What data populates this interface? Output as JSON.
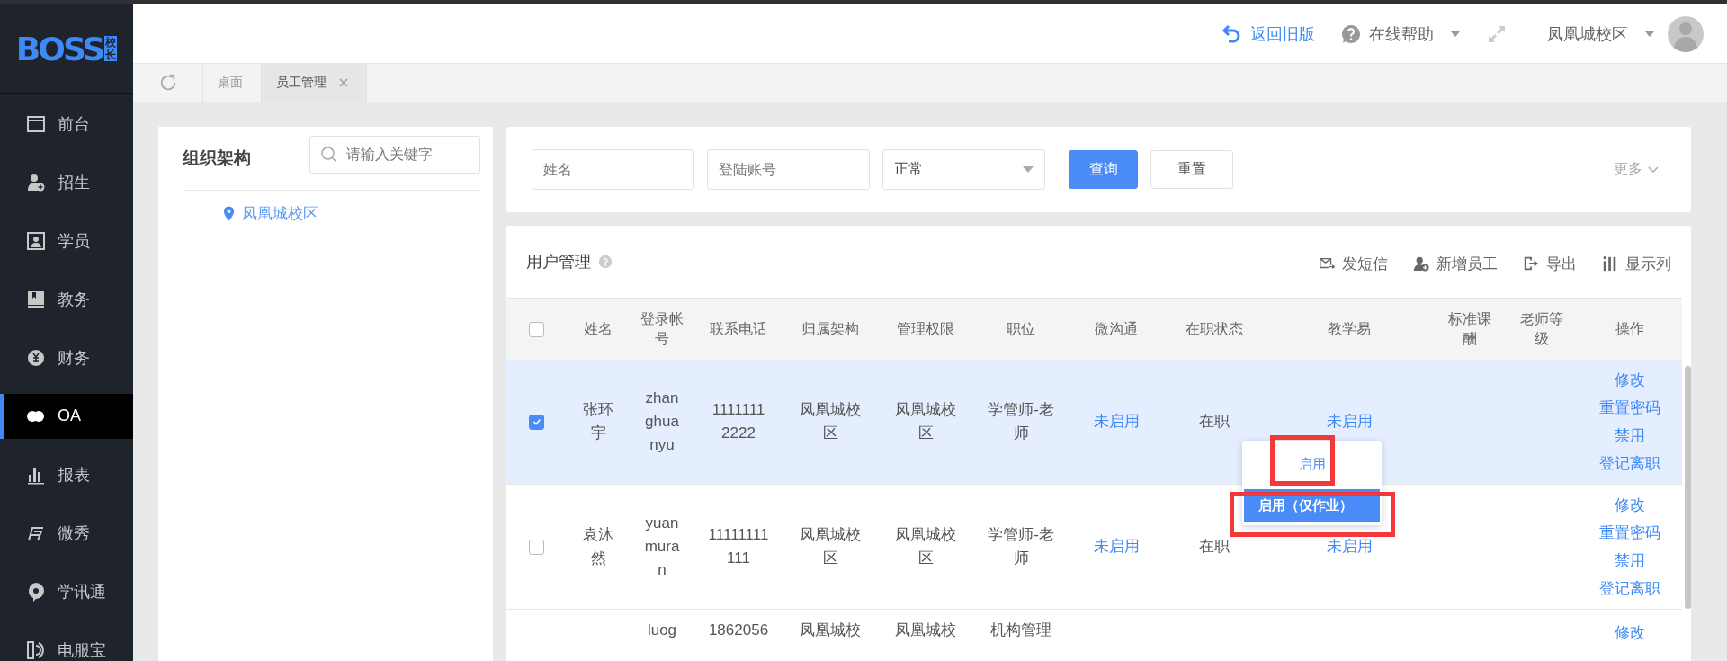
{
  "logo": {
    "text": "BOSS",
    "badge": "校长"
  },
  "sidebar": {
    "items": [
      {
        "label": "前台",
        "selected": false
      },
      {
        "label": "招生",
        "selected": false
      },
      {
        "label": "学员",
        "selected": false
      },
      {
        "label": "教务",
        "selected": false
      },
      {
        "label": "财务",
        "selected": false
      },
      {
        "label": "OA",
        "selected": true
      },
      {
        "label": "报表",
        "selected": false
      },
      {
        "label": "微秀",
        "selected": false
      },
      {
        "label": "学讯通",
        "selected": false
      },
      {
        "label": "电服宝",
        "selected": false
      }
    ]
  },
  "header": {
    "back_link": "返回旧版",
    "help": "在线帮助",
    "campus": "凤凰城校区"
  },
  "tabs": [
    {
      "label": "桌面",
      "selected": false,
      "closable": false
    },
    {
      "label": "员工管理",
      "selected": true,
      "closable": true
    }
  ],
  "org_panel": {
    "title": "组织架构",
    "search_placeholder": "请输入关键字",
    "tree": [
      {
        "label": "凤凰城校区"
      }
    ]
  },
  "filters": {
    "name_placeholder": "姓名",
    "account_placeholder": "登陆账号",
    "status_value": "正常",
    "query": "查询",
    "reset": "重置",
    "more": "更多"
  },
  "user_table": {
    "title": "用户管理",
    "select_all_checked": false,
    "actions": [
      "发短信",
      "新增员工",
      "导出",
      "显示列"
    ],
    "columns": [
      "姓名",
      "登录帐号",
      "联系电话",
      "归属架构",
      "管理权限",
      "职位",
      "微沟通",
      "在职状态",
      "教学易",
      "标准课酬",
      "老师等级",
      "操作"
    ],
    "rows": [
      {
        "selected": true,
        "name": "张环宇",
        "account": "zhanghuanyu",
        "phone": "11111112222",
        "org": "凤凰城校区",
        "permission": "凤凰城校区",
        "position": "学管师-老师",
        "wechat": "未启用",
        "status": "在职",
        "jiaoxueyi": "未启用",
        "ops": [
          "修改",
          "重置密码",
          "禁用",
          "登记离职"
        ]
      },
      {
        "selected": false,
        "name": "袁沐然",
        "account": "yuanmuran",
        "phone": "11111111111",
        "org": "凤凰城校区",
        "permission": "凤凰城校区",
        "position": "学管师-老师",
        "wechat": "未启用",
        "status": "在职",
        "jiaoxueyi": "未启用",
        "ops": [
          "修改",
          "重置密码",
          "禁用",
          "登记离职"
        ]
      },
      {
        "account": "luog",
        "phone": "1862056",
        "org": "凤凰城校",
        "permission": "凤凰城校",
        "position": "机构管理",
        "ops": [
          "修改"
        ]
      }
    ],
    "dropdown": {
      "items": [
        {
          "label": "启用",
          "selected": false,
          "marked": true
        },
        {
          "label": "启用（仅作业）",
          "selected": true,
          "marked": true
        }
      ]
    }
  }
}
